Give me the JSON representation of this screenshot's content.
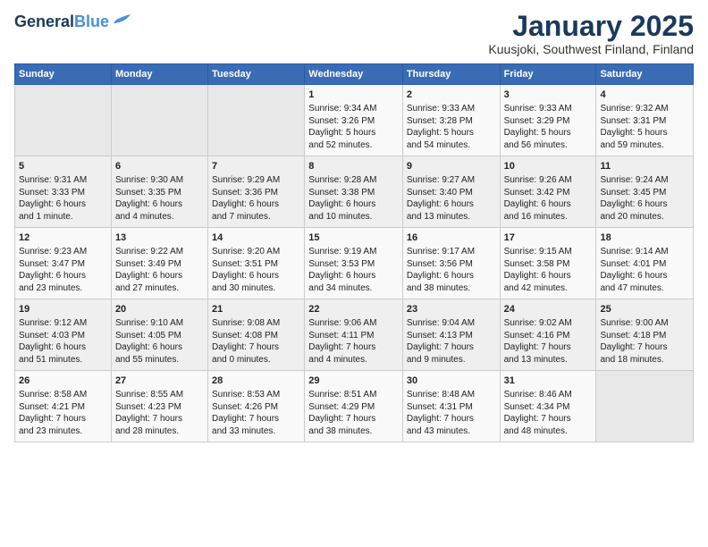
{
  "header": {
    "logo_general": "General",
    "logo_blue": "Blue",
    "month_title": "January 2025",
    "location": "Kuusjoki, Southwest Finland, Finland"
  },
  "weekdays": [
    "Sunday",
    "Monday",
    "Tuesday",
    "Wednesday",
    "Thursday",
    "Friday",
    "Saturday"
  ],
  "weeks": [
    [
      {
        "day": "",
        "content": ""
      },
      {
        "day": "",
        "content": ""
      },
      {
        "day": "",
        "content": ""
      },
      {
        "day": "1",
        "content": "Sunrise: 9:34 AM\nSunset: 3:26 PM\nDaylight: 5 hours\nand 52 minutes."
      },
      {
        "day": "2",
        "content": "Sunrise: 9:33 AM\nSunset: 3:28 PM\nDaylight: 5 hours\nand 54 minutes."
      },
      {
        "day": "3",
        "content": "Sunrise: 9:33 AM\nSunset: 3:29 PM\nDaylight: 5 hours\nand 56 minutes."
      },
      {
        "day": "4",
        "content": "Sunrise: 9:32 AM\nSunset: 3:31 PM\nDaylight: 5 hours\nand 59 minutes."
      }
    ],
    [
      {
        "day": "5",
        "content": "Sunrise: 9:31 AM\nSunset: 3:33 PM\nDaylight: 6 hours\nand 1 minute."
      },
      {
        "day": "6",
        "content": "Sunrise: 9:30 AM\nSunset: 3:35 PM\nDaylight: 6 hours\nand 4 minutes."
      },
      {
        "day": "7",
        "content": "Sunrise: 9:29 AM\nSunset: 3:36 PM\nDaylight: 6 hours\nand 7 minutes."
      },
      {
        "day": "8",
        "content": "Sunrise: 9:28 AM\nSunset: 3:38 PM\nDaylight: 6 hours\nand 10 minutes."
      },
      {
        "day": "9",
        "content": "Sunrise: 9:27 AM\nSunset: 3:40 PM\nDaylight: 6 hours\nand 13 minutes."
      },
      {
        "day": "10",
        "content": "Sunrise: 9:26 AM\nSunset: 3:42 PM\nDaylight: 6 hours\nand 16 minutes."
      },
      {
        "day": "11",
        "content": "Sunrise: 9:24 AM\nSunset: 3:45 PM\nDaylight: 6 hours\nand 20 minutes."
      }
    ],
    [
      {
        "day": "12",
        "content": "Sunrise: 9:23 AM\nSunset: 3:47 PM\nDaylight: 6 hours\nand 23 minutes."
      },
      {
        "day": "13",
        "content": "Sunrise: 9:22 AM\nSunset: 3:49 PM\nDaylight: 6 hours\nand 27 minutes."
      },
      {
        "day": "14",
        "content": "Sunrise: 9:20 AM\nSunset: 3:51 PM\nDaylight: 6 hours\nand 30 minutes."
      },
      {
        "day": "15",
        "content": "Sunrise: 9:19 AM\nSunset: 3:53 PM\nDaylight: 6 hours\nand 34 minutes."
      },
      {
        "day": "16",
        "content": "Sunrise: 9:17 AM\nSunset: 3:56 PM\nDaylight: 6 hours\nand 38 minutes."
      },
      {
        "day": "17",
        "content": "Sunrise: 9:15 AM\nSunset: 3:58 PM\nDaylight: 6 hours\nand 42 minutes."
      },
      {
        "day": "18",
        "content": "Sunrise: 9:14 AM\nSunset: 4:01 PM\nDaylight: 6 hours\nand 47 minutes."
      }
    ],
    [
      {
        "day": "19",
        "content": "Sunrise: 9:12 AM\nSunset: 4:03 PM\nDaylight: 6 hours\nand 51 minutes."
      },
      {
        "day": "20",
        "content": "Sunrise: 9:10 AM\nSunset: 4:05 PM\nDaylight: 6 hours\nand 55 minutes."
      },
      {
        "day": "21",
        "content": "Sunrise: 9:08 AM\nSunset: 4:08 PM\nDaylight: 7 hours\nand 0 minutes."
      },
      {
        "day": "22",
        "content": "Sunrise: 9:06 AM\nSunset: 4:11 PM\nDaylight: 7 hours\nand 4 minutes."
      },
      {
        "day": "23",
        "content": "Sunrise: 9:04 AM\nSunset: 4:13 PM\nDaylight: 7 hours\nand 9 minutes."
      },
      {
        "day": "24",
        "content": "Sunrise: 9:02 AM\nSunset: 4:16 PM\nDaylight: 7 hours\nand 13 minutes."
      },
      {
        "day": "25",
        "content": "Sunrise: 9:00 AM\nSunset: 4:18 PM\nDaylight: 7 hours\nand 18 minutes."
      }
    ],
    [
      {
        "day": "26",
        "content": "Sunrise: 8:58 AM\nSunset: 4:21 PM\nDaylight: 7 hours\nand 23 minutes."
      },
      {
        "day": "27",
        "content": "Sunrise: 8:55 AM\nSunset: 4:23 PM\nDaylight: 7 hours\nand 28 minutes."
      },
      {
        "day": "28",
        "content": "Sunrise: 8:53 AM\nSunset: 4:26 PM\nDaylight: 7 hours\nand 33 minutes."
      },
      {
        "day": "29",
        "content": "Sunrise: 8:51 AM\nSunset: 4:29 PM\nDaylight: 7 hours\nand 38 minutes."
      },
      {
        "day": "30",
        "content": "Sunrise: 8:48 AM\nSunset: 4:31 PM\nDaylight: 7 hours\nand 43 minutes."
      },
      {
        "day": "31",
        "content": "Sunrise: 8:46 AM\nSunset: 4:34 PM\nDaylight: 7 hours\nand 48 minutes."
      },
      {
        "day": "",
        "content": ""
      }
    ]
  ]
}
